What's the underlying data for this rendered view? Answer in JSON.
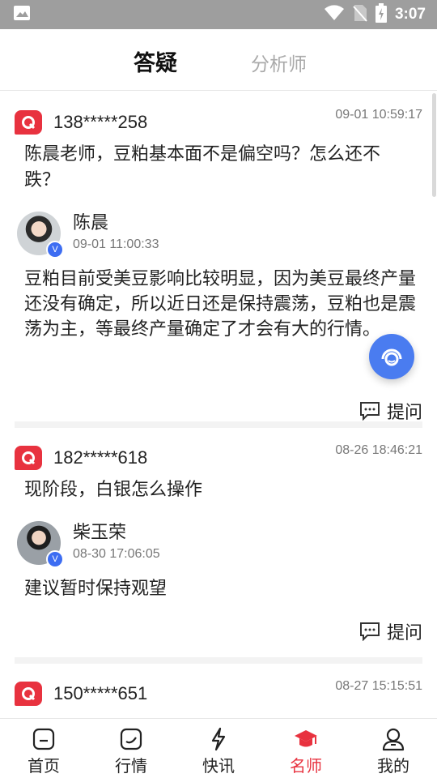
{
  "status_bar": {
    "time": "3:07"
  },
  "tabs": [
    {
      "label": "答疑",
      "active": true
    },
    {
      "label": "分析师",
      "active": false
    }
  ],
  "qa_items": [
    {
      "user": "138*****258",
      "question_time": "09-01 10:59:17",
      "question": "陈晨老师，豆粕基本面不是偏空吗？怎么还不跌？",
      "analyst": "陈晨",
      "answer_time": "09-01 11:00:33",
      "answer": "豆粕目前受美豆影响比较明显，因为美豆最终产量还没有确定，所以近日还是保持震荡，豆粕也是震荡为主，等最终产量确定了才会有大的行情。",
      "ask_label": "提问"
    },
    {
      "user": "182*****618",
      "question_time": "08-26 18:46:21",
      "question": "现阶段，白银怎么操作",
      "analyst": "柴玉荣",
      "answer_time": "08-30 17:06:05",
      "answer": "建议暂时保持观望",
      "ask_label": "提问"
    },
    {
      "user": "150*****651",
      "question_time": "08-27 15:15:51"
    }
  ],
  "verified_badge": "V",
  "bottom_nav": [
    {
      "label": "首页",
      "icon": "home-icon",
      "active": false
    },
    {
      "label": "行情",
      "icon": "chart-icon",
      "active": false
    },
    {
      "label": "快讯",
      "icon": "lightning-icon",
      "active": false
    },
    {
      "label": "名师",
      "icon": "graduation-cap-icon",
      "active": true
    },
    {
      "label": "我的",
      "icon": "user-icon",
      "active": false
    }
  ],
  "colors": {
    "accent": "#e8323f",
    "fab": "#4a7cf0",
    "verified": "#3d6df2"
  }
}
